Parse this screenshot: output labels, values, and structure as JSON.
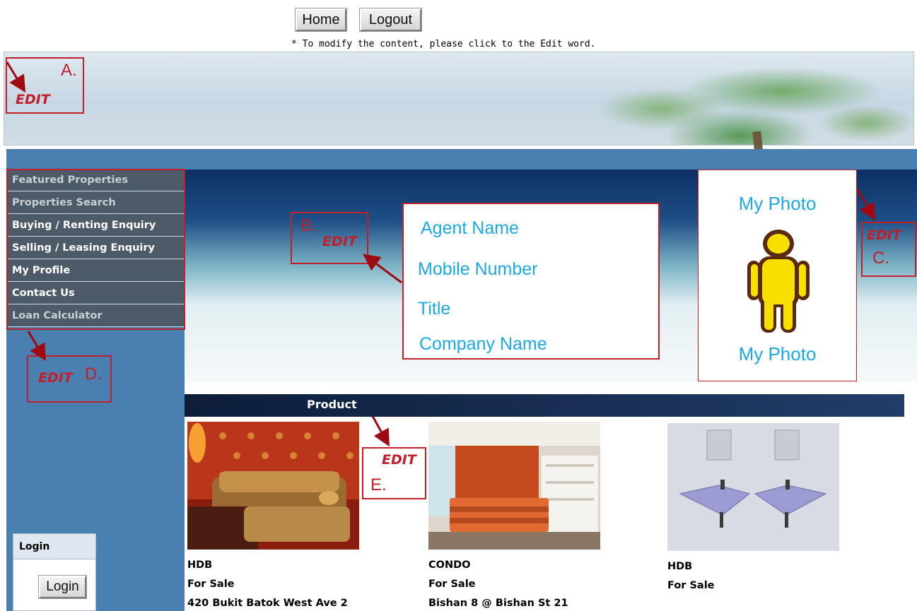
{
  "toolbar": {
    "home_label": "Home",
    "logout_label": "Logout"
  },
  "instruction_note": "* To modify the content, please click to the Edit word.",
  "sidebar": {
    "items": [
      {
        "label": "Featured Properties"
      },
      {
        "label": "Properties Search"
      },
      {
        "label": "Buying / Renting Enquiry"
      },
      {
        "label": "Selling / Leasing Enquiry"
      },
      {
        "label": "My Profile"
      },
      {
        "label": "Contact Us"
      },
      {
        "label": "Loan Calculator"
      }
    ]
  },
  "agent": {
    "name": "Agent Name",
    "mobile": "Mobile Number",
    "title": "Title",
    "company": "Company Name"
  },
  "photo": {
    "top_caption": "My Photo",
    "bottom_caption": "My Photo"
  },
  "annotations": {
    "edit_word": "EDIT",
    "a": "A.",
    "b": "B.",
    "c": "C.",
    "d": "D.",
    "e": "E."
  },
  "product": {
    "title": "Product",
    "items": [
      {
        "type": "HDB",
        "status": "For Sale",
        "address": "420 Bukit Batok West Ave 2"
      },
      {
        "type": "CONDO",
        "status": "For Sale",
        "address": "Bishan 8 @ Bishan St 21"
      },
      {
        "type": "HDB",
        "status": "For Sale",
        "address": ""
      }
    ]
  },
  "login": {
    "header": "Login",
    "button_label": "Login"
  },
  "colors": {
    "accent_red": "#c0202a",
    "cyan_text": "#1ea7e0",
    "sidebar_blue": "#4a7fb2",
    "menu_gray": "#4d5b69"
  }
}
